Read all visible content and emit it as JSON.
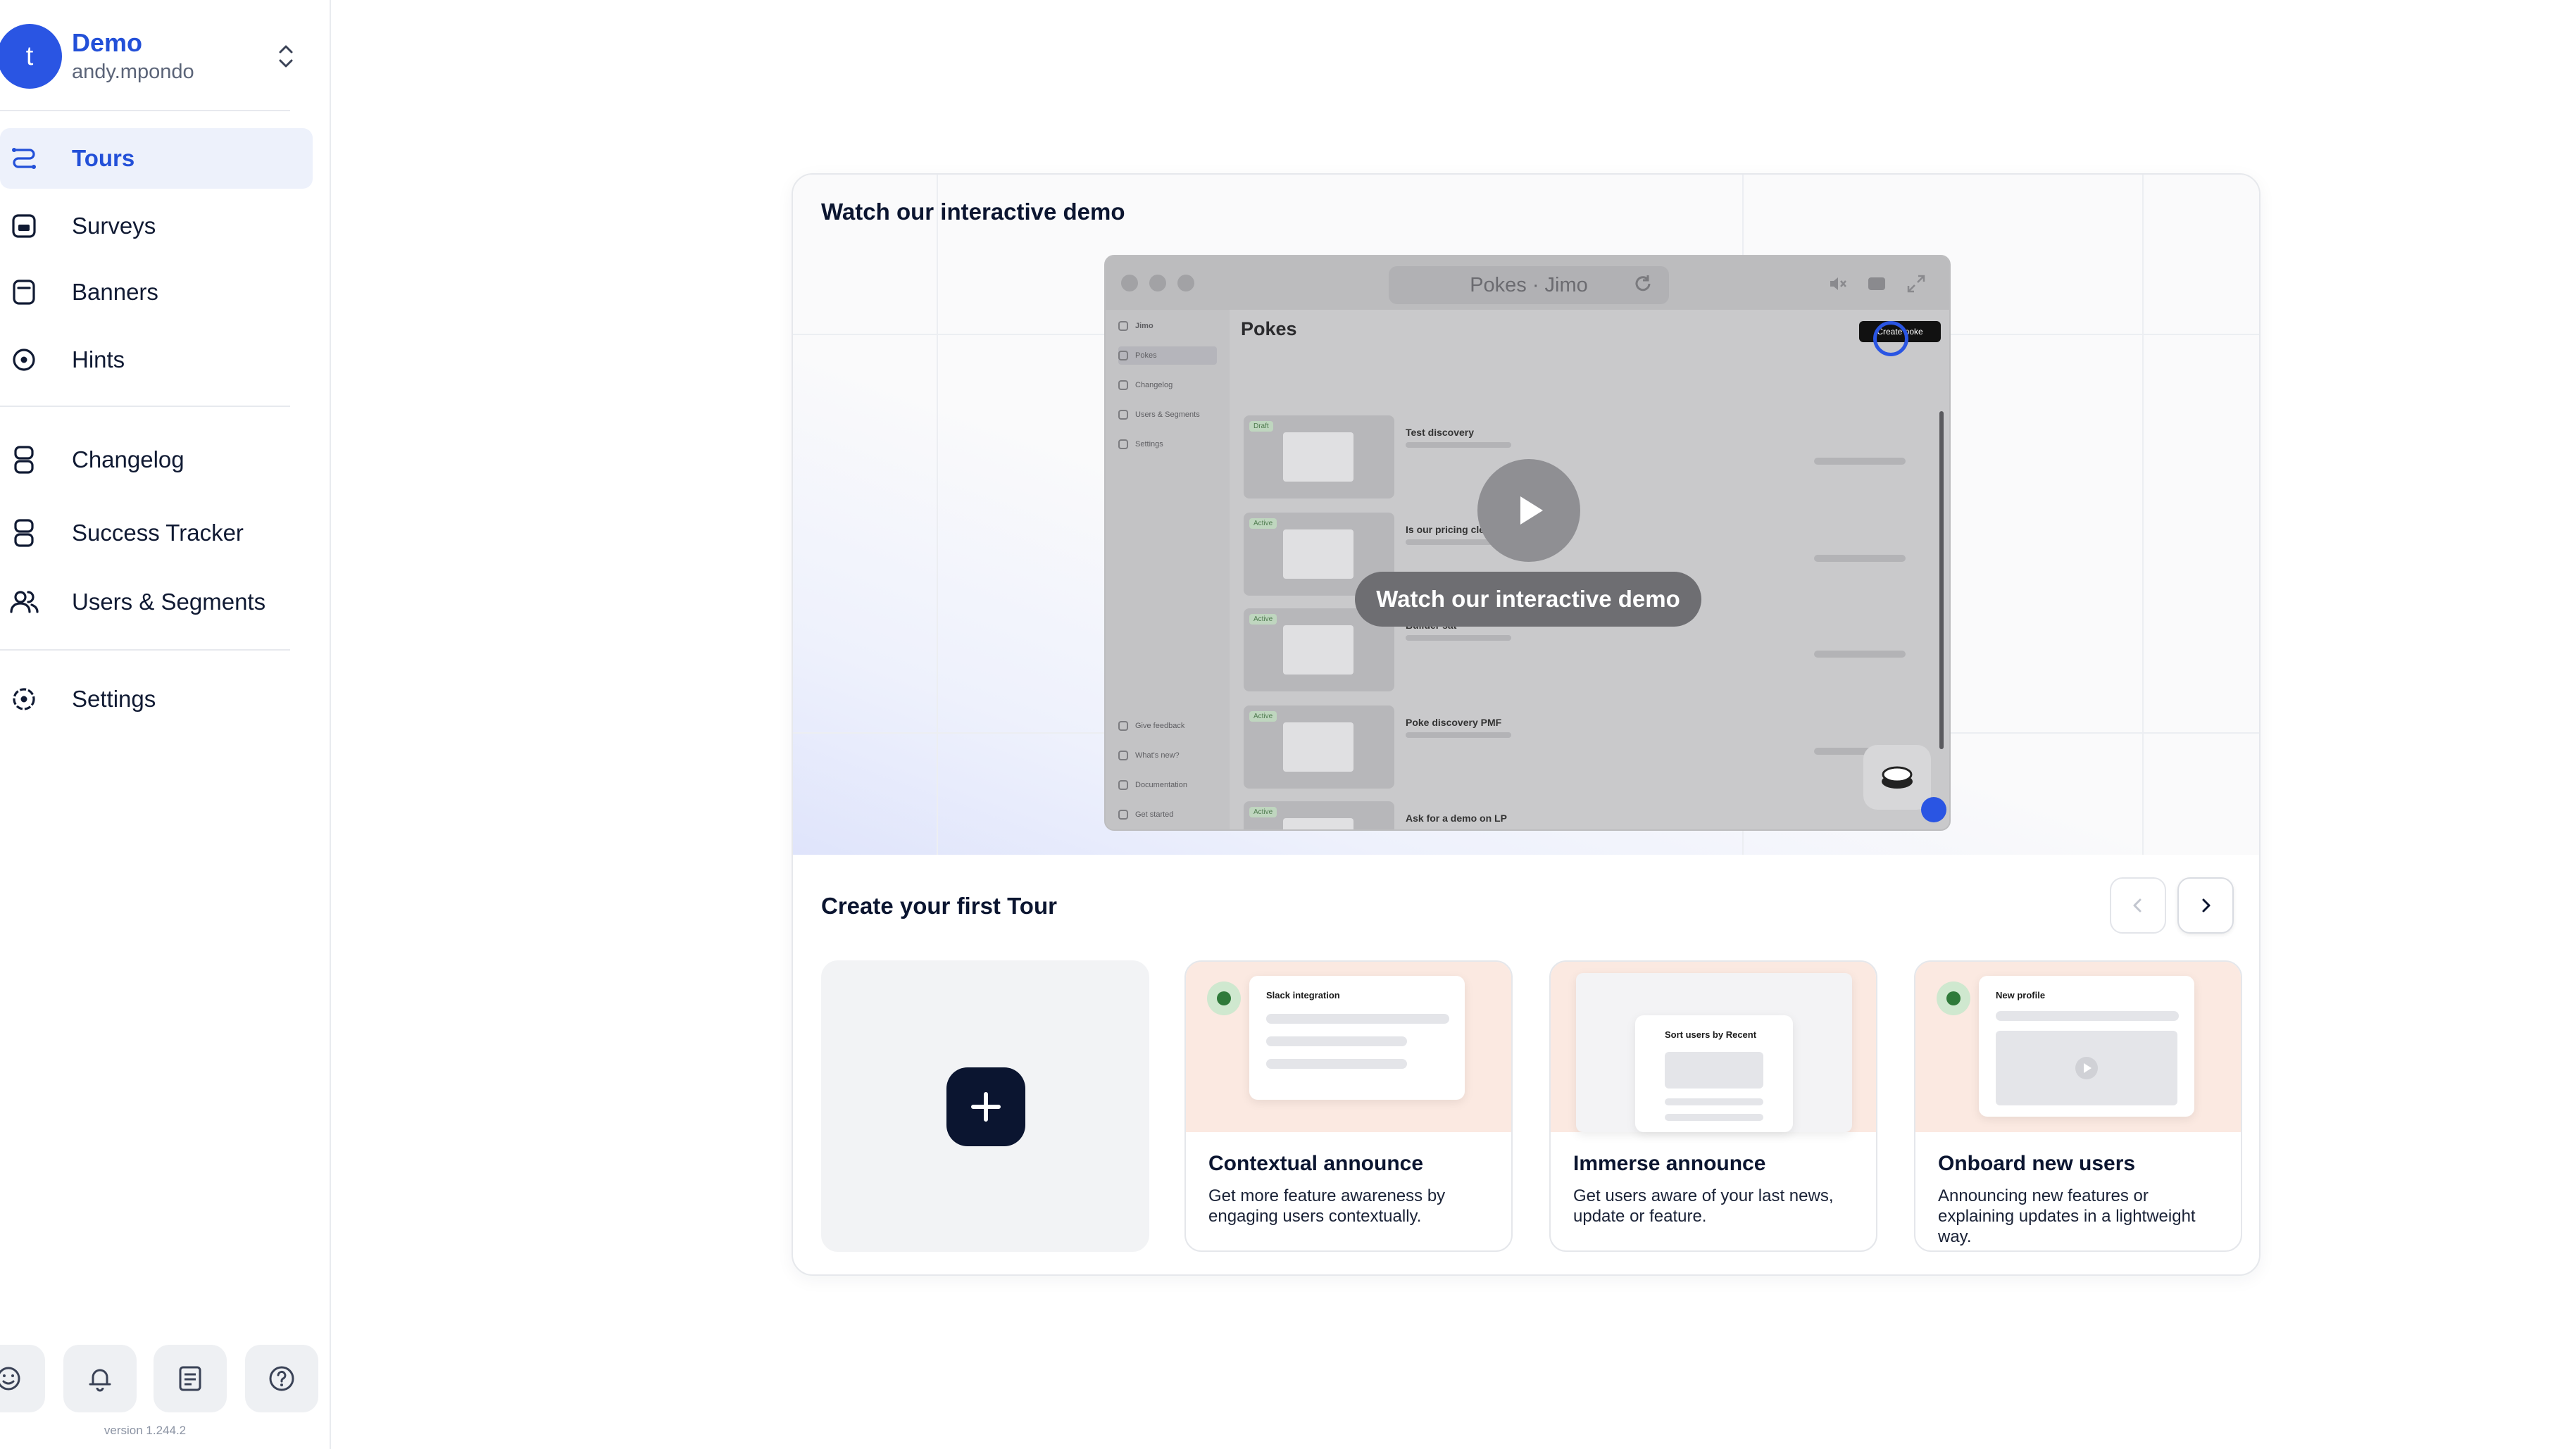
{
  "workspace": {
    "avatar_letter": "t",
    "name": "Demo",
    "user": "andy.mpondo"
  },
  "nav": {
    "tours": "Tours",
    "surveys": "Surveys",
    "banners": "Banners",
    "hints": "Hints",
    "changelog": "Changelog",
    "success_tracker": "Success Tracker",
    "users_segments": "Users & Segments",
    "settings": "Settings"
  },
  "active_nav": "Tours",
  "version": "version 1.244.2",
  "demo": {
    "title": "Watch our interactive demo",
    "video_url": "Pokes · Jimo",
    "watch_label": "Watch our interactive demo",
    "mock": {
      "brand": "Jimo",
      "page_title": "Pokes",
      "side_items": [
        "Pokes",
        "Changelog",
        "Users & Segments",
        "Settings"
      ],
      "side_bottom": [
        "Give feedback",
        "What's new?",
        "Documentation",
        "Get started"
      ],
      "rows": [
        {
          "tag": "Draft",
          "name": "Test discovery"
        },
        {
          "tag": "Active",
          "name": "Is our pricing clear?"
        },
        {
          "tag": "Active",
          "name": "Builder sat"
        },
        {
          "tag": "Active",
          "name": "Poke discovery PMF"
        },
        {
          "tag": "Active",
          "name": "Ask for a demo on LP"
        }
      ],
      "create_label": "Create poke"
    }
  },
  "create": {
    "title": "Create your first Tour",
    "templates": [
      {
        "name": "Contextual announce",
        "desc": "Get more feature awareness by engaging users contextually.",
        "art_title": "Slack integration"
      },
      {
        "name": "Immerse announce",
        "desc": "Get users aware of your last news, update or feature.",
        "art_title": "Sort users by Recent"
      },
      {
        "name": "Onboard new users",
        "desc": "Announcing new features or explaining updates in a lightweight way.",
        "art_title": "New profile"
      }
    ]
  },
  "colors": {
    "accent": "#2350d8",
    "active_bg": "#edf1fb",
    "dark": "#0b1530",
    "tile_art": "#fbe9e1"
  }
}
